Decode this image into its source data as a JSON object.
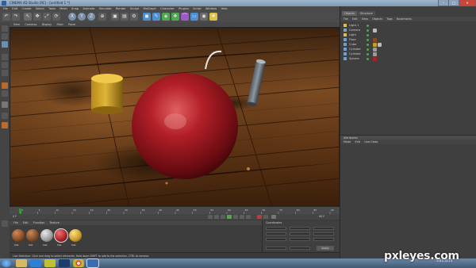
{
  "window": {
    "title": "CINEMA 4D Studio (RC) - [untitled 1 *]",
    "buttons": [
      "–",
      "□",
      "✕"
    ]
  },
  "menubar": [
    "File",
    "Edit",
    "Create",
    "Select",
    "Tools",
    "Mesh",
    "Snap",
    "Animate",
    "Simulate",
    "Render",
    "Sculpt",
    "MoGraph",
    "Character",
    "Plugins",
    "Script",
    "Window",
    "Help"
  ],
  "viewport": {
    "menu": [
      "View",
      "Cameras",
      "Display",
      "Filter",
      "Panel"
    ]
  },
  "timeline": {
    "start_frame": "0 F",
    "end_frame": "90 F",
    "ticks": [
      "0",
      "5",
      "10",
      "15",
      "20",
      "25",
      "30",
      "35",
      "40",
      "45",
      "50",
      "55",
      "60",
      "65",
      "70",
      "75",
      "80",
      "85",
      "90"
    ]
  },
  "materials": {
    "menu": [
      "File",
      "Edit",
      "Function",
      "Texture"
    ],
    "items": [
      {
        "label": "Mat",
        "color": "#8a4a22"
      },
      {
        "label": "Mat",
        "color": "#7a4a2a"
      },
      {
        "label": "Mat",
        "color": "#9a9a9a"
      },
      {
        "label": "Mat",
        "color": "#a8222a"
      },
      {
        "label": "Mat",
        "color": "#c89a2a"
      }
    ]
  },
  "coordinates": {
    "header": "Coordinates",
    "apply_label": "Apply"
  },
  "status": {
    "text": "Live Selection: Click and drag to select elements. Hold down SHIFT to add to the selection, CTRL to remove."
  },
  "objects_panel": {
    "tabs": [
      "Objects",
      "Structure"
    ],
    "menu": [
      "File",
      "Edit",
      "View",
      "Objects",
      "Tags",
      "Bookmarks"
    ],
    "items": [
      {
        "name": "Light.1",
        "icon_color": "#e0c040",
        "tags": []
      },
      {
        "name": "Camera",
        "icon_color": "#7fa0c0",
        "tags": [
          "#bbbbbb"
        ]
      },
      {
        "name": "Light",
        "icon_color": "#e0c040",
        "tags": []
      },
      {
        "name": "Floor",
        "icon_color": "#70a0d0",
        "tags": [
          "#8a4a22"
        ]
      },
      {
        "name": "Cube",
        "icon_color": "#70a0d0",
        "tags": [
          "#c89a2a",
          "#bbbbbb"
        ]
      },
      {
        "name": "Cylinder",
        "icon_color": "#70a0d0",
        "tags": [
          "#9a9a9a"
        ]
      },
      {
        "name": "Cylinder",
        "icon_color": "#70a0d0",
        "tags": [
          "#9a9a9a"
        ]
      },
      {
        "name": "Sphere",
        "icon_color": "#70a0d0",
        "tags": [
          "#a8222a"
        ]
      }
    ]
  },
  "attributes_panel": {
    "header": "Attributes",
    "menu": [
      "Mode",
      "Edit",
      "User Data"
    ]
  },
  "taskbar": {
    "apps": [
      {
        "name": "start-orb",
        "color": "#3b78c4"
      },
      {
        "name": "explorer",
        "color": "#d8b860"
      },
      {
        "name": "media-player",
        "color": "#2f7fd4"
      },
      {
        "name": "winamp",
        "color": "#c0c030"
      },
      {
        "name": "photoshop",
        "color": "#1f3d6a"
      },
      {
        "name": "chrome",
        "color": "#d04030"
      },
      {
        "name": "cinema4d",
        "color": "#3a6ab0"
      }
    ],
    "clock_time": "",
    "clock_date": "2012-12-13"
  },
  "watermark": "pxleyes.com"
}
